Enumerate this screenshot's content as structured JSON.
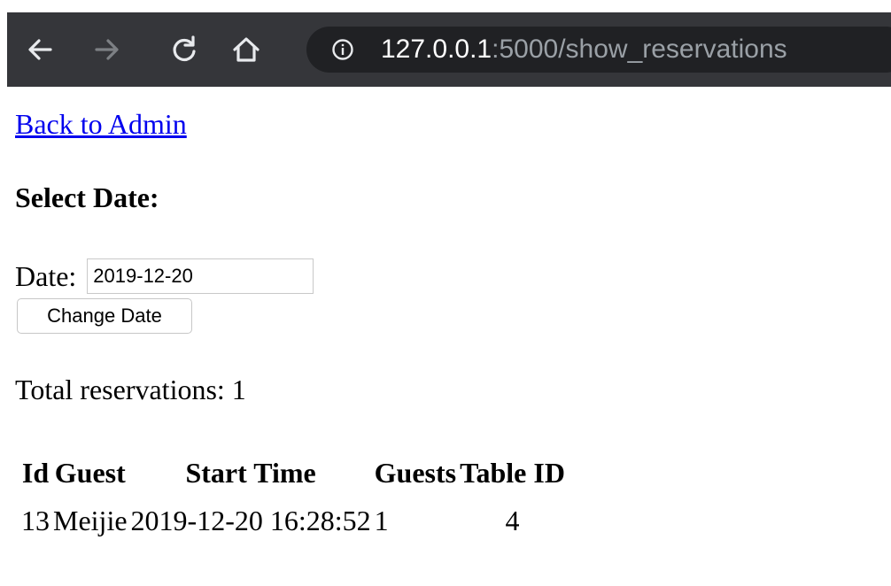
{
  "browser": {
    "url_host": "127.0.0.1",
    "url_path": ":5000/show_reservations",
    "toolbar_color": "#35363a",
    "omnibox_color": "#202124"
  },
  "page": {
    "back_link": "Back to Admin",
    "heading": "Select Date:",
    "date_label": "Date:",
    "date_value": "2019-12-20",
    "change_button": "Change Date",
    "total_text": "Total reservations: 1",
    "link_color": "#0000ee"
  },
  "table": {
    "headers": {
      "id": "Id",
      "guest": "Guest",
      "start_time": "Start Time",
      "guests": "Guests",
      "table_id": "Table ID"
    },
    "rows": [
      {
        "id": "13",
        "guest": "Meijie",
        "start_time": "2019-12-20 16:28:52",
        "guests": "1",
        "table_id": "4"
      }
    ]
  }
}
